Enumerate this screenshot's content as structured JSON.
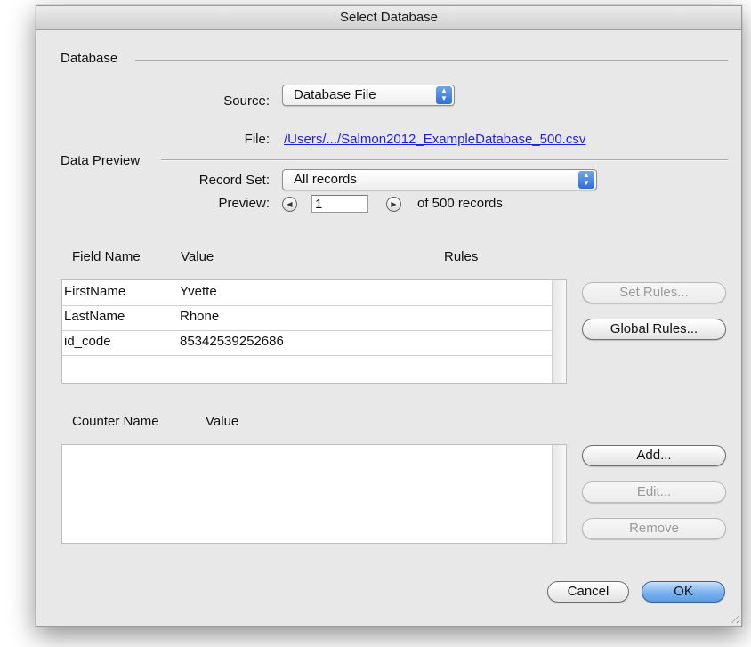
{
  "window": {
    "title": "Select Database"
  },
  "database": {
    "section_label": "Database",
    "source_label": "Source:",
    "source_value": "Database File",
    "file_label": "File:",
    "file_path": "/Users/.../Salmon2012_ExampleDatabase_500.csv"
  },
  "preview": {
    "section_label": "Data Preview",
    "record_set_label": "Record Set:",
    "record_set_value": "All records",
    "preview_label": "Preview:",
    "current_record": "1",
    "of_text": "of 500 records"
  },
  "fields": {
    "headers": {
      "name": "Field Name",
      "value": "Value",
      "rules": "Rules"
    },
    "rows": [
      {
        "name": "FirstName",
        "value": "Yvette",
        "rules": ""
      },
      {
        "name": "LastName",
        "value": "Rhone",
        "rules": ""
      },
      {
        "name": "id_code",
        "value": "85342539252686",
        "rules": ""
      }
    ],
    "set_rules_label": "Set Rules...",
    "global_rules_label": "Global Rules..."
  },
  "counters": {
    "headers": {
      "name": "Counter Name",
      "value": "Value"
    },
    "rows": [],
    "add_label": "Add...",
    "edit_label": "Edit...",
    "remove_label": "Remove"
  },
  "footer": {
    "cancel_label": "Cancel",
    "ok_label": "OK"
  },
  "icons": {
    "popup_arrows": "up-down-arrows-icon",
    "prev": "left-arrow-circle-icon",
    "next": "right-arrow-circle-icon",
    "resize": "resize-grip-icon"
  },
  "colors": {
    "accent": "#5c9ce6",
    "link": "#1f1fe0"
  }
}
